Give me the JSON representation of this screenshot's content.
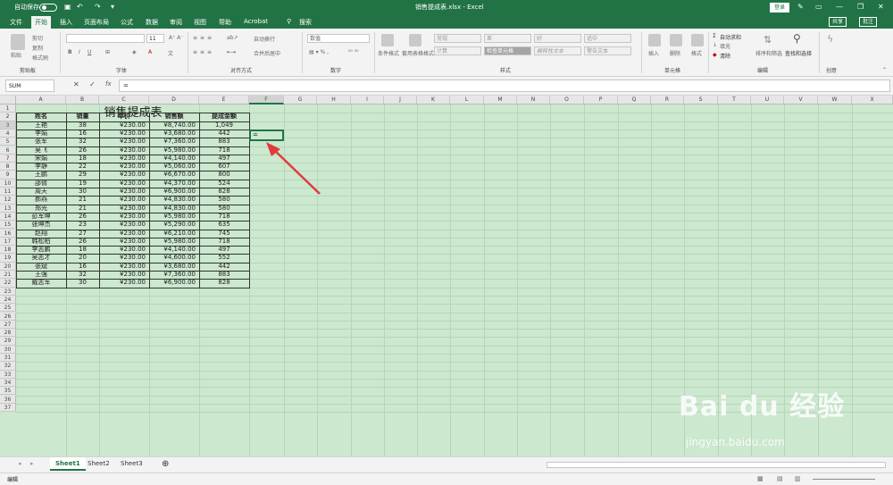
{
  "titlebar": {
    "autosave": "自动保存",
    "filename": "销售提成表.xlsx - Excel",
    "search": "搜索",
    "login": "登录"
  },
  "menu": {
    "tabs": [
      "文件",
      "开始",
      "插入",
      "页面布局",
      "公式",
      "数据",
      "审阅",
      "视图",
      "帮助",
      "Acrobat"
    ],
    "search_placeholder": "搜索",
    "share": "共享",
    "comment": "批注"
  },
  "ribbon": {
    "clipboard": {
      "paste": "粘贴",
      "cut": "剪切",
      "copy": "复制",
      "format_painter": "格式刷",
      "label": "剪贴板"
    },
    "font": {
      "label": "字体",
      "size": "11"
    },
    "alignment": {
      "wrap": "自动换行",
      "merge": "合并后居中",
      "label": "对齐方式"
    },
    "number": {
      "format": "数值",
      "label": "数字"
    },
    "styles": {
      "conditional": "条件格式",
      "table": "套用表格格式",
      "boxes": [
        "常规",
        "差",
        "好",
        "适中",
        "计算",
        "检查单元格",
        "解释性文本",
        "警告文本"
      ],
      "label": "样式"
    },
    "cells": {
      "insert": "插入",
      "delete": "删除",
      "format": "格式",
      "label": "单元格"
    },
    "editing": {
      "autosum": "自动求和",
      "fill": "填充",
      "clear": "清除",
      "sort": "排序和筛选",
      "find": "查找和选择",
      "label": "编辑"
    },
    "create": {
      "label": "创意"
    }
  },
  "formula_bar": {
    "name_box": "SUM",
    "fx": "fx",
    "formula": "="
  },
  "columns": [
    "A",
    "B",
    "C",
    "D",
    "E",
    "F",
    "G",
    "H",
    "I",
    "J",
    "K",
    "L",
    "M",
    "N",
    "O",
    "P",
    "Q",
    "R",
    "S",
    "T",
    "U",
    "V",
    "W",
    "X"
  ],
  "rows": [
    "1",
    "2",
    "3",
    "4",
    "5",
    "6",
    "7",
    "8",
    "9",
    "10",
    "11",
    "12",
    "13",
    "14",
    "15",
    "16",
    "17",
    "18",
    "19",
    "20",
    "21",
    "22",
    "23",
    "24",
    "25",
    "26",
    "27",
    "28",
    "29",
    "30",
    "31",
    "32",
    "33",
    "34",
    "35",
    "36",
    "37"
  ],
  "table": {
    "title": "销售提成表",
    "headers": [
      "姓名",
      "销量",
      "单价",
      "销售额",
      "提成金额"
    ],
    "rows": [
      [
        "王艳",
        "38",
        "¥230.00",
        "¥8,740.00",
        "1,049"
      ],
      [
        "李娟",
        "16",
        "¥230.00",
        "¥3,680.00",
        "442"
      ],
      [
        "张军",
        "32",
        "¥230.00",
        "¥7,360.00",
        "883"
      ],
      [
        "吴飞",
        "26",
        "¥230.00",
        "¥5,980.00",
        "718"
      ],
      [
        "宋娟",
        "18",
        "¥230.00",
        "¥4,140.00",
        "497"
      ],
      [
        "李静",
        "22",
        "¥230.00",
        "¥5,060.00",
        "607"
      ],
      [
        "王鹏",
        "29",
        "¥230.00",
        "¥6,670.00",
        "800"
      ],
      [
        "邵倩",
        "19",
        "¥230.00",
        "¥4,370.00",
        "524"
      ],
      [
        "周天",
        "30",
        "¥230.00",
        "¥6,900.00",
        "828"
      ],
      [
        "郝燕",
        "21",
        "¥230.00",
        "¥4,830.00",
        "580"
      ],
      [
        "郑光",
        "21",
        "¥230.00",
        "¥4,830.00",
        "580"
      ],
      [
        "彭军坤",
        "26",
        "¥230.00",
        "¥5,980.00",
        "718"
      ],
      [
        "张坤杰",
        "23",
        "¥230.00",
        "¥5,290.00",
        "635"
      ],
      [
        "赵翔",
        "27",
        "¥230.00",
        "¥6,210.00",
        "745"
      ],
      [
        "韩松柏",
        "26",
        "¥230.00",
        "¥5,980.00",
        "718"
      ],
      [
        "李志鹏",
        "18",
        "¥230.00",
        "¥4,140.00",
        "497"
      ],
      [
        "吴志才",
        "20",
        "¥230.00",
        "¥4,600.00",
        "552"
      ],
      [
        "张斌",
        "16",
        "¥230.00",
        "¥3,680.00",
        "442"
      ],
      [
        "王强",
        "32",
        "¥230.00",
        "¥7,360.00",
        "883"
      ],
      [
        "戴志军",
        "30",
        "¥230.00",
        "¥6,900.00",
        "828"
      ]
    ],
    "active_cell_value": "="
  },
  "sheet_tabs": [
    "Sheet1",
    "Sheet2",
    "Sheet3"
  ],
  "status": {
    "mode": "编辑"
  },
  "watermark": {
    "brand": "Bai du 经验",
    "url": "jingyan.baidu.com"
  },
  "colors": {
    "excel_green": "#217346",
    "sheet_bg": "#cce8cf",
    "arrow": "#e03c3c"
  }
}
